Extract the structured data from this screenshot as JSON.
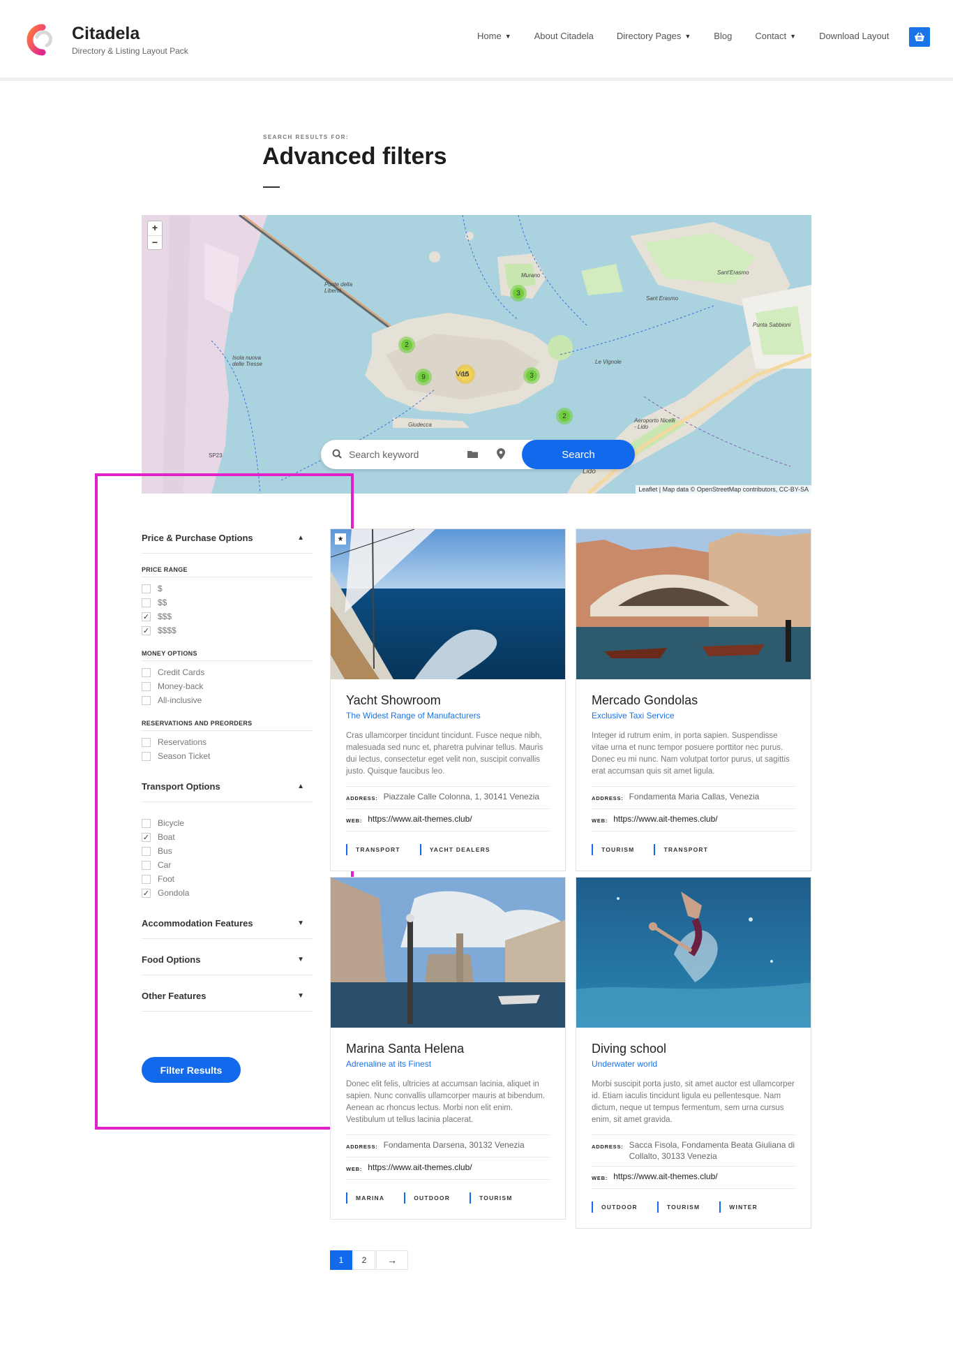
{
  "brand": {
    "title": "Citadela",
    "subtitle": "Directory & Listing Layout Pack"
  },
  "nav": [
    {
      "label": "Home",
      "dropdown": true
    },
    {
      "label": "About Citadela",
      "dropdown": false
    },
    {
      "label": "Directory Pages",
      "dropdown": true
    },
    {
      "label": "Blog",
      "dropdown": false
    },
    {
      "label": "Contact",
      "dropdown": true
    },
    {
      "label": "Download Layout",
      "dropdown": false
    }
  ],
  "page": {
    "search_label": "SEARCH RESULTS FOR:",
    "title": "Advanced filters"
  },
  "map": {
    "zoom_in": "+",
    "zoom_out": "−",
    "clusters": [
      "3",
      "2",
      "9",
      "15",
      "3",
      "2"
    ],
    "labels": [
      "Sant'Erasmo",
      "Sant Erasmo",
      "Punta Sabbioni",
      "Murano",
      "Ponte della Libertà",
      "Giudecca",
      "Lido",
      "Ven",
      "SP23",
      "Le Vignole",
      "Isola nuova delle Tresse",
      "Aeroporto Nicelli - Lido"
    ],
    "attribution": "Leaflet | Map data © OpenStreetMap contributors, CC-BY-SA",
    "search_placeholder": "Search keyword",
    "search_button": "Search"
  },
  "colors": {
    "accent": "#1269eb",
    "highlight": "#e020c8"
  },
  "sidebar": {
    "sections": [
      {
        "title": "Price & Purchase Options",
        "expanded": true
      },
      {
        "title": "Transport Options",
        "expanded": true
      },
      {
        "title": "Accommodation Features",
        "expanded": false
      },
      {
        "title": "Food Options",
        "expanded": false
      },
      {
        "title": "Other Features",
        "expanded": false
      }
    ],
    "price_range": {
      "title": "PRICE RANGE",
      "options": [
        {
          "label": "$",
          "checked": false
        },
        {
          "label": "$$",
          "checked": false
        },
        {
          "label": "$$$",
          "checked": true
        },
        {
          "label": "$$$$",
          "checked": true
        }
      ]
    },
    "money_options": {
      "title": "MONEY OPTIONS",
      "options": [
        {
          "label": "Credit Cards",
          "checked": false
        },
        {
          "label": "Money-back",
          "checked": false
        },
        {
          "label": "All-inclusive",
          "checked": false
        }
      ]
    },
    "reservations": {
      "title": "RESERVATIONS AND PREORDERS",
      "options": [
        {
          "label": "Reservations",
          "checked": false
        },
        {
          "label": "Season Ticket",
          "checked": false
        }
      ]
    },
    "transport": {
      "options": [
        {
          "label": "Bicycle",
          "checked": false
        },
        {
          "label": "Boat",
          "checked": true
        },
        {
          "label": "Bus",
          "checked": false
        },
        {
          "label": "Car",
          "checked": false
        },
        {
          "label": "Foot",
          "checked": false
        },
        {
          "label": "Gondola",
          "checked": true
        }
      ]
    },
    "filter_button": "Filter Results"
  },
  "listing_labels": {
    "address": "ADDRESS:",
    "web": "WEB:"
  },
  "listings": [
    {
      "title": "Yacht Showroom",
      "tagline": "The Widest Range of Manufacturers",
      "description": "Cras ullamcorper tincidunt tincidunt. Fusce neque nibh, malesuada sed nunc et, pharetra pulvinar tellus. Mauris dui lectus, consectetur eget velit non, suscipit convallis justo. Quisque faucibus leo.",
      "address": "Piazzale Calle Colonna, 1, 30141 Venezia",
      "web": "https://www.ait-themes.club/",
      "categories": [
        "TRANSPORT",
        "YACHT DEALERS"
      ],
      "featured": true,
      "featured_icon": "star-icon"
    },
    {
      "title": "Mercado Gondolas",
      "tagline": "Exclusive Taxi Service",
      "description": "Integer id rutrum enim, in porta sapien. Suspendisse vitae urna et nunc tempor posuere porttitor nec purus. Donec eu mi nunc. Nam volutpat tortor purus, ut sagittis erat accumsan quis sit amet ligula.",
      "address": "Fondamenta Maria Callas, Venezia",
      "web": "https://www.ait-themes.club/",
      "categories": [
        "TOURISM",
        "TRANSPORT"
      ],
      "featured": false
    },
    {
      "title": "Marina Santa Helena",
      "tagline": "Adrenaline at its Finest",
      "description": "Donec elit felis, ultricies at accumsan lacinia, aliquet in sapien. Nunc convallis ullamcorper mauris at bibendum. Aenean ac rhoncus lectus. Morbi non elit enim. Vestibulum ut tellus lacinia placerat.",
      "address": "Fondamenta Darsena, 30132 Venezia",
      "web": "https://www.ait-themes.club/",
      "categories": [
        "MARINA",
        "OUTDOOR",
        "TOURISM"
      ],
      "featured": false
    },
    {
      "title": "Diving school",
      "tagline": "Underwater world",
      "description": "Morbi suscipit porta justo, sit amet auctor est ullamcorper id. Etiam iaculis tincidunt ligula eu pellentesque. Nam dictum, neque ut tempus fermentum, sem urna cursus enim, sit amet gravida.",
      "address": "Sacca Fisola, Fondamenta Beata Giuliana di Collalto, 30133 Venezia",
      "web": "https://www.ait-themes.club/",
      "categories": [
        "OUTDOOR",
        "TOURISM",
        "WINTER"
      ],
      "featured": false
    }
  ],
  "pagination": {
    "pages": [
      "1",
      "2"
    ],
    "current": "1",
    "next": "→"
  }
}
